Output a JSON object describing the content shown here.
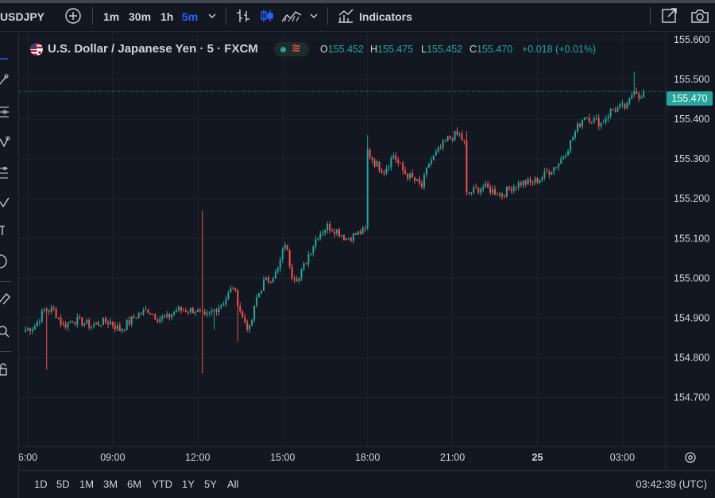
{
  "toolbar": {
    "symbol": "USDJPY",
    "intervals": [
      "1m",
      "30m",
      "1h",
      "5m"
    ],
    "active_interval": "5m",
    "indicators_label": "Indicators",
    "icons": [
      "add-symbol-icon",
      "interval-dropdown-icon",
      "bar-style-icon",
      "candle-style-icon",
      "area-style-icon",
      "chart-type-dropdown-icon",
      "indicators-icon",
      "fullscreen-icon",
      "snapshot-icon"
    ]
  },
  "left_toolbar": {
    "icons": [
      "cursor-icon",
      "trend-line-icon",
      "fib-retracement-icon",
      "pattern-icon",
      "prediction-icon",
      "brush-icon",
      "text-icon",
      "measure-icon",
      "ruler-icon",
      "zoom-icon",
      "lock-icon"
    ]
  },
  "legend": {
    "title": "U.S. Dollar / Japanese Yen · 5 · FXCM",
    "open_label": "O",
    "open": "155.452",
    "high_label": "H",
    "high": "155.475",
    "low_label": "L",
    "low": "155.452",
    "close_label": "C",
    "close": "155.470",
    "change": "+0.018 (+0.01%)"
  },
  "price_tag": "155.470",
  "bottom": {
    "ranges": [
      "1D",
      "5D",
      "1M",
      "3M",
      "6M",
      "YTD",
      "1Y",
      "5Y",
      "All"
    ],
    "clock": "03:42:39 (UTC)"
  },
  "colors": {
    "background": "#131722",
    "grid": "#1e222d",
    "up": "#26a69a",
    "down": "#ef5350",
    "text": "#d1d4dc",
    "accent": "#2962ff"
  },
  "chart_data": {
    "type": "candlestick",
    "symbol": "USDJPY",
    "interval": "5",
    "y_ticks": [
      "155.600",
      "155.500",
      "155.400",
      "155.300",
      "155.200",
      "155.100",
      "155.000",
      "154.900",
      "154.800",
      "154.700"
    ],
    "ylim": [
      154.695,
      155.605
    ],
    "x_ticks": [
      {
        "label": "6:00",
        "bar": 1
      },
      {
        "label": "09:00",
        "bar": 37
      },
      {
        "label": "12:00",
        "bar": 73
      },
      {
        "label": "15:00",
        "bar": 109
      },
      {
        "label": "18:00",
        "bar": 145
      },
      {
        "label": "21:00",
        "bar": 181
      },
      {
        "label": "25",
        "bar": 217
      },
      {
        "label": "03:00",
        "bar": 253
      }
    ],
    "last_price": 155.47,
    "anchors": [
      [
        0,
        154.87
      ],
      [
        4,
        154.88
      ],
      [
        8,
        154.92
      ],
      [
        12,
        154.92
      ],
      [
        16,
        154.88
      ],
      [
        20,
        154.895
      ],
      [
        24,
        154.89
      ],
      [
        28,
        154.88
      ],
      [
        32,
        154.89
      ],
      [
        36,
        154.89
      ],
      [
        40,
        154.87
      ],
      [
        44,
        154.89
      ],
      [
        48,
        154.91
      ],
      [
        52,
        154.92
      ],
      [
        56,
        154.9
      ],
      [
        60,
        154.9
      ],
      [
        64,
        154.92
      ],
      [
        68,
        154.92
      ],
      [
        72,
        154.92
      ],
      [
        76,
        154.9
      ],
      [
        80,
        154.92
      ],
      [
        84,
        154.94
      ],
      [
        88,
        154.98
      ],
      [
        92,
        154.9
      ],
      [
        95,
        154.87
      ],
      [
        98,
        154.95
      ],
      [
        101,
        154.99
      ],
      [
        104,
        155.0
      ],
      [
        107,
        155.02
      ],
      [
        110,
        155.09
      ],
      [
        113,
        155.01
      ],
      [
        116,
        155.0
      ],
      [
        120,
        155.06
      ],
      [
        124,
        155.11
      ],
      [
        128,
        155.13
      ],
      [
        132,
        155.12
      ],
      [
        136,
        155.1
      ],
      [
        140,
        155.11
      ],
      [
        144,
        155.12
      ],
      [
        145,
        155.32
      ],
      [
        148,
        155.29
      ],
      [
        152,
        155.27
      ],
      [
        156,
        155.31
      ],
      [
        160,
        155.27
      ],
      [
        164,
        155.25
      ],
      [
        168,
        155.23
      ],
      [
        171,
        155.29
      ],
      [
        175,
        155.32
      ],
      [
        179,
        155.35
      ],
      [
        182,
        155.36
      ],
      [
        184,
        155.36
      ],
      [
        186,
        155.34
      ],
      [
        187,
        155.21
      ],
      [
        190,
        155.22
      ],
      [
        194,
        155.23
      ],
      [
        198,
        155.22
      ],
      [
        202,
        155.21
      ],
      [
        206,
        155.23
      ],
      [
        210,
        155.24
      ],
      [
        214,
        155.24
      ],
      [
        218,
        155.25
      ],
      [
        222,
        155.27
      ],
      [
        226,
        155.29
      ],
      [
        230,
        155.33
      ],
      [
        234,
        155.38
      ],
      [
        237,
        155.41
      ],
      [
        240,
        155.4
      ],
      [
        244,
        155.39
      ],
      [
        248,
        155.42
      ],
      [
        252,
        155.43
      ],
      [
        255,
        155.43
      ],
      [
        258,
        155.48
      ],
      [
        261,
        155.45
      ],
      [
        262,
        155.47
      ]
    ],
    "spikes": [
      {
        "bar": 9,
        "low": 154.77
      },
      {
        "bar": 75,
        "high": 155.17
      },
      {
        "bar": 75,
        "low": 154.76
      },
      {
        "bar": 80,
        "low": 154.87
      },
      {
        "bar": 90,
        "low": 154.84
      },
      {
        "bar": 145,
        "high": 155.36
      },
      {
        "bar": 187,
        "high": 155.37
      },
      {
        "bar": 258,
        "high": 155.52
      }
    ]
  }
}
